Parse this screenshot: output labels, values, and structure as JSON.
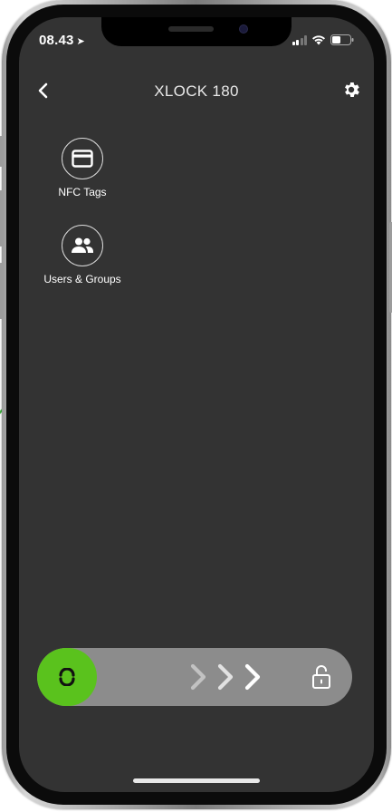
{
  "status_bar": {
    "time": "08.43",
    "location_icon": "location-arrow-icon",
    "signal_icon": "cellular-signal-icon",
    "wifi_icon": "wifi-icon",
    "battery_icon": "battery-icon"
  },
  "header": {
    "title": "XLOCK 180",
    "back_icon": "chevron-left-icon",
    "settings_icon": "gear-icon"
  },
  "menu": {
    "items": [
      {
        "label": "NFC Tags",
        "icon": "card-icon"
      },
      {
        "label": "Users & Groups",
        "icon": "users-icon"
      }
    ]
  },
  "slider": {
    "handle_icon": "unlock-handle-icon",
    "arrows_icon": "triple-chevron-right-icon",
    "lock_icon": "unlocked-padlock-icon",
    "handle_color": "#5ac21d",
    "track_color": "#8c8c8c"
  },
  "colors": {
    "screen_background": "#333333",
    "accent": "#5ac21d"
  }
}
